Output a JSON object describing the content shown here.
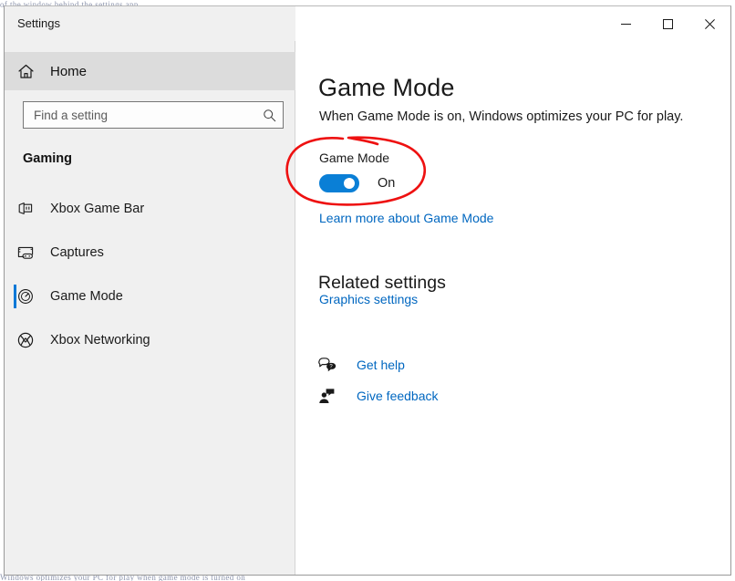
{
  "window": {
    "title": "Settings",
    "controls": [
      {
        "name": "minimize",
        "glyph": "minimize-icon"
      },
      {
        "name": "maximize",
        "glyph": "maximize-icon"
      },
      {
        "name": "close",
        "glyph": "close-icon"
      }
    ]
  },
  "background": {
    "top_line": "of the window behind the settings app",
    "bottom_line": "Windows optimizes your PC for play when game mode is turned on"
  },
  "sidebar": {
    "home": {
      "label": "Home",
      "icon": "home-icon"
    },
    "search": {
      "value": "",
      "placeholder": "Find a setting",
      "icon": "search-icon"
    },
    "category": "Gaming",
    "items": [
      {
        "label": "Xbox Game Bar",
        "icon": "game-bar-icon",
        "selected": false
      },
      {
        "label": "Captures",
        "icon": "captures-icon",
        "selected": false
      },
      {
        "label": "Game Mode",
        "icon": "game-mode-icon",
        "selected": true
      },
      {
        "label": "Xbox Networking",
        "icon": "xbox-networking-icon",
        "selected": false
      }
    ]
  },
  "main": {
    "title": "Game Mode",
    "description": "When Game Mode is on, Windows optimizes your PC for play.",
    "toggle": {
      "label": "Game Mode",
      "state_text": "On",
      "checked": true
    },
    "learn_more_link": "Learn more about Game Mode",
    "related_settings": {
      "heading": "Related settings",
      "links": [
        "Graphics settings"
      ]
    },
    "help_links": [
      {
        "label": "Get help",
        "icon": "get-help-icon"
      },
      {
        "label": "Give feedback",
        "icon": "give-feedback-icon"
      }
    ]
  },
  "annotation": {
    "shape": "hand-drawn-ellipse",
    "color": "#ee1111",
    "targets": "game-mode-toggle"
  },
  "colors": {
    "accent": "#0078d7",
    "toggle_on": "#0a7fd6",
    "link": "#0067c0",
    "sidebar_bg": "#f0f0f0",
    "home_row_bg": "#dcdcdc",
    "annotation_red": "#ee1111"
  }
}
